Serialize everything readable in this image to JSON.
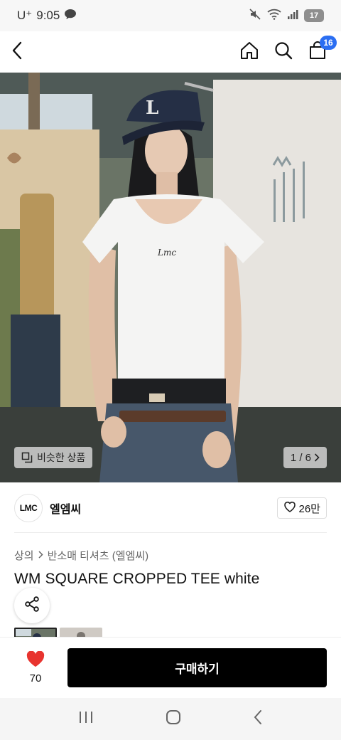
{
  "status_bar": {
    "carrier": "U⁺",
    "time": "9:05",
    "battery": "17"
  },
  "app_bar": {
    "cart_count": "16"
  },
  "hero": {
    "similar_label": "비슷한 상품",
    "page_indicator": "1 / 6"
  },
  "brand": {
    "logo_text": "LMC",
    "name": "엘엠씨",
    "likes": "26만"
  },
  "breadcrumb": {
    "level1": "상의",
    "level2": "반소매 티셔츠 (엘엠씨)"
  },
  "product": {
    "title": "WM SQUARE CROPPED TEE white"
  },
  "action_bar": {
    "heart_count": "70",
    "buy_label": "구매하기"
  },
  "colors": {
    "accent_badge": "#2b6ef2",
    "heart": "#e8342f",
    "buy_button": "#000000"
  }
}
